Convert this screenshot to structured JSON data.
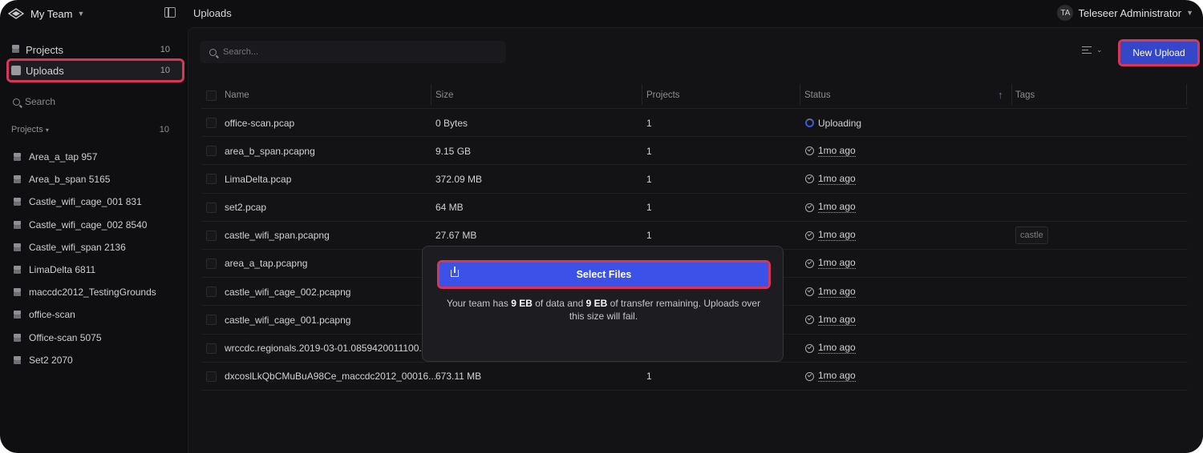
{
  "header": {
    "team_name": "My Team",
    "page_title": "Uploads",
    "user_initials": "TA",
    "user_name": "Teleseer Administrator"
  },
  "sidebar": {
    "nav": [
      {
        "label": "Projects",
        "count": "10",
        "icon": "layers-icon"
      },
      {
        "label": "Uploads",
        "count": "10",
        "icon": "upload-box-icon",
        "active": true
      }
    ],
    "search_label": "Search",
    "projects_heading": "Projects",
    "projects_count": "10",
    "projects": [
      "Area_a_tap 957",
      "Area_b_span 5165",
      "Castle_wifi_cage_001 831",
      "Castle_wifi_cage_002 8540",
      "Castle_wifi_span 2136",
      "LimaDelta 6811",
      "maccdc2012_TestingGrounds",
      "office-scan",
      "Office-scan 5075",
      "Set2 2070"
    ]
  },
  "toolbar": {
    "search_placeholder": "Search...",
    "new_upload_label": "New Upload"
  },
  "table": {
    "columns": [
      "Name",
      "Size",
      "Projects",
      "Status",
      "Tags"
    ],
    "rows": [
      {
        "name": "office-scan.pcap",
        "size": "0 Bytes",
        "projects": "1",
        "status": "Uploading",
        "status_type": "uploading",
        "tag": ""
      },
      {
        "name": "area_b_span.pcapng",
        "size": "9.15 GB",
        "projects": "1",
        "status": "1mo ago",
        "status_type": "done",
        "tag": ""
      },
      {
        "name": "LimaDelta.pcap",
        "size": "372.09 MB",
        "projects": "1",
        "status": "1mo ago",
        "status_type": "done",
        "tag": ""
      },
      {
        "name": "set2.pcap",
        "size": "64 MB",
        "projects": "1",
        "status": "1mo ago",
        "status_type": "done",
        "tag": ""
      },
      {
        "name": "castle_wifi_span.pcapng",
        "size": "27.67 MB",
        "projects": "1",
        "status": "1mo ago",
        "status_type": "done",
        "tag": "castle"
      },
      {
        "name": "area_a_tap.pcapng",
        "size": "",
        "projects": "",
        "status": "1mo ago",
        "status_type": "done",
        "tag": ""
      },
      {
        "name": "castle_wifi_cage_002.pcapng",
        "size": "",
        "projects": "",
        "status": "1mo ago",
        "status_type": "done",
        "tag": ""
      },
      {
        "name": "castle_wifi_cage_001.pcapng",
        "size": "",
        "projects": "",
        "status": "1mo ago",
        "status_type": "done",
        "tag": ""
      },
      {
        "name": "wrccdc.regionals.2019-03-01.0859420011100...",
        "size": "",
        "projects": "",
        "status": "1mo ago",
        "status_type": "done",
        "tag": ""
      },
      {
        "name": "dxcoslLkQbCMuBuA98Ce_maccdc2012_00016...",
        "size": "673.11 MB",
        "projects": "1",
        "status": "1mo ago",
        "status_type": "done",
        "tag": ""
      }
    ]
  },
  "modal": {
    "select_files_label": "Select Files",
    "text_pre": "Your team has ",
    "data_amount": "9 EB",
    "text_mid": " of data and ",
    "transfer_amount": "9 EB",
    "text_post": " of transfer remaining. Uploads over this size will fail."
  },
  "colors": {
    "accent": "#3c51e8",
    "highlight": "#d6365a",
    "background": "#0f0f11"
  }
}
